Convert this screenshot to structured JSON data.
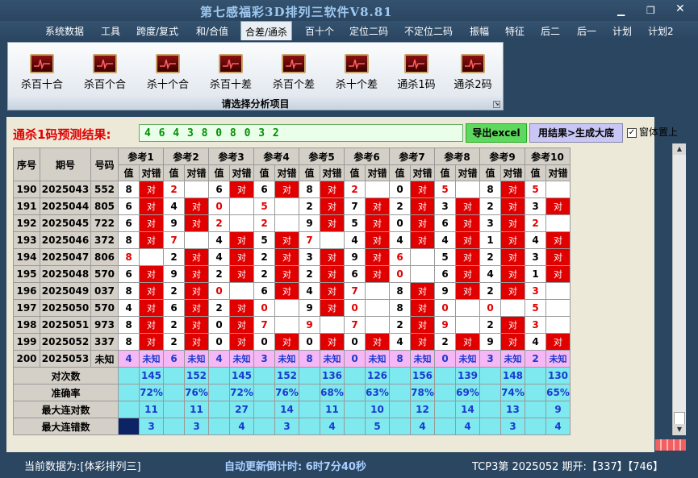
{
  "window": {
    "title": "第七感福彩3D排列三软件V8.81"
  },
  "menu": [
    "系统数据",
    "工具",
    "跨度/复式",
    "和/合值",
    "合差/通杀",
    "百十个",
    "定位二码",
    "不定位二码",
    "振幅",
    "特征",
    "后二",
    "后一",
    "计划",
    "计划2"
  ],
  "menu_active_index": 4,
  "ribbon": {
    "buttons": [
      "杀百十合",
      "杀百个合",
      "杀十个合",
      "杀百十差",
      "杀百个差",
      "杀十个差",
      "通杀1码",
      "通杀2码"
    ],
    "footer": "请选择分析项目"
  },
  "result": {
    "label": "通杀1码预测结果:",
    "value": "4 6 4 3 8 0 8 0 3 2",
    "excel_button": "导出excel",
    "generate_button": "用结果>生成大底",
    "checkbox_label": "窗体置上",
    "checkbox_checked": true
  },
  "table": {
    "headers": {
      "seq": "序号",
      "period": "期号",
      "number": "号码"
    },
    "ref_labels": [
      "参考1",
      "参考2",
      "参考3",
      "参考4",
      "参考5",
      "参考6",
      "参考7",
      "参考8",
      "参考9",
      "参考10"
    ],
    "sub_value": "值",
    "sub_result": "对错",
    "hit_text": "对",
    "rows": [
      {
        "seq": "190",
        "period": "2025043",
        "number": "552",
        "refs": [
          [
            "8",
            1
          ],
          [
            "2",
            0
          ],
          [
            "6",
            1
          ],
          [
            "6",
            1
          ],
          [
            "8",
            1
          ],
          [
            "2",
            0
          ],
          [
            "0",
            1
          ],
          [
            "5",
            0
          ],
          [
            "8",
            1
          ],
          [
            "5",
            0
          ]
        ]
      },
      {
        "seq": "191",
        "period": "2025044",
        "number": "805",
        "refs": [
          [
            "6",
            1
          ],
          [
            "4",
            1
          ],
          [
            "0",
            0
          ],
          [
            "5",
            0
          ],
          [
            "2",
            1
          ],
          [
            "7",
            1
          ],
          [
            "2",
            1
          ],
          [
            "3",
            1
          ],
          [
            "2",
            1
          ],
          [
            "3",
            1
          ]
        ]
      },
      {
        "seq": "192",
        "period": "2025045",
        "number": "722",
        "refs": [
          [
            "6",
            1
          ],
          [
            "9",
            1
          ],
          [
            "2",
            0
          ],
          [
            "2",
            0
          ],
          [
            "9",
            1
          ],
          [
            "5",
            1
          ],
          [
            "0",
            1
          ],
          [
            "6",
            1
          ],
          [
            "3",
            1
          ],
          [
            "2",
            0
          ]
        ]
      },
      {
        "seq": "193",
        "period": "2025046",
        "number": "372",
        "refs": [
          [
            "8",
            1
          ],
          [
            "7",
            0
          ],
          [
            "4",
            1
          ],
          [
            "5",
            1
          ],
          [
            "7",
            0
          ],
          [
            "4",
            1
          ],
          [
            "4",
            1
          ],
          [
            "4",
            1
          ],
          [
            "1",
            1
          ],
          [
            "4",
            1
          ]
        ]
      },
      {
        "seq": "194",
        "period": "2025047",
        "number": "806",
        "refs": [
          [
            "8",
            0
          ],
          [
            "2",
            1
          ],
          [
            "4",
            1
          ],
          [
            "2",
            1
          ],
          [
            "3",
            1
          ],
          [
            "9",
            1
          ],
          [
            "6",
            0
          ],
          [
            "5",
            1
          ],
          [
            "2",
            1
          ],
          [
            "3",
            1
          ]
        ]
      },
      {
        "seq": "195",
        "period": "2025048",
        "number": "570",
        "refs": [
          [
            "6",
            1
          ],
          [
            "9",
            1
          ],
          [
            "2",
            1
          ],
          [
            "2",
            1
          ],
          [
            "2",
            1
          ],
          [
            "6",
            1
          ],
          [
            "0",
            0
          ],
          [
            "6",
            1
          ],
          [
            "4",
            1
          ],
          [
            "1",
            1
          ]
        ]
      },
      {
        "seq": "196",
        "period": "2025049",
        "number": "037",
        "refs": [
          [
            "8",
            1
          ],
          [
            "2",
            1
          ],
          [
            "0",
            0
          ],
          [
            "6",
            1
          ],
          [
            "4",
            1
          ],
          [
            "7",
            0
          ],
          [
            "8",
            1
          ],
          [
            "9",
            1
          ],
          [
            "2",
            1
          ],
          [
            "3",
            0
          ]
        ]
      },
      {
        "seq": "197",
        "period": "2025050",
        "number": "570",
        "refs": [
          [
            "4",
            1
          ],
          [
            "6",
            1
          ],
          [
            "2",
            1
          ],
          [
            "0",
            0
          ],
          [
            "9",
            1
          ],
          [
            "0",
            0
          ],
          [
            "8",
            1
          ],
          [
            "0",
            0
          ],
          [
            "0",
            0
          ],
          [
            "5",
            0
          ]
        ]
      },
      {
        "seq": "198",
        "period": "2025051",
        "number": "973",
        "refs": [
          [
            "8",
            1
          ],
          [
            "2",
            1
          ],
          [
            "0",
            1
          ],
          [
            "7",
            0
          ],
          [
            "9",
            0
          ],
          [
            "7",
            0
          ],
          [
            "2",
            1
          ],
          [
            "9",
            0
          ],
          [
            "2",
            1
          ],
          [
            "3",
            0
          ]
        ]
      },
      {
        "seq": "199",
        "period": "2025052",
        "number": "337",
        "refs": [
          [
            "8",
            1
          ],
          [
            "2",
            1
          ],
          [
            "0",
            1
          ],
          [
            "0",
            1
          ],
          [
            "0",
            1
          ],
          [
            "0",
            1
          ],
          [
            "4",
            1
          ],
          [
            "2",
            1
          ],
          [
            "9",
            1
          ],
          [
            "4",
            1
          ]
        ]
      }
    ],
    "pending": {
      "seq": "200",
      "period": "2025053",
      "number": "未知",
      "values": [
        "4",
        "6",
        "4",
        "3",
        "8",
        "0",
        "8",
        "0",
        "3",
        "2"
      ],
      "result": "未知"
    },
    "stats": [
      {
        "label": "对次数",
        "values": [
          "145",
          "152",
          "145",
          "152",
          "136",
          "126",
          "156",
          "139",
          "148",
          "130"
        ]
      },
      {
        "label": "准确率",
        "values": [
          "72%",
          "76%",
          "72%",
          "76%",
          "68%",
          "63%",
          "78%",
          "69%",
          "74%",
          "65%"
        ]
      },
      {
        "label": "最大连对数",
        "values": [
          "11",
          "11",
          "27",
          "14",
          "11",
          "10",
          "12",
          "14",
          "13",
          "9"
        ]
      },
      {
        "label": "最大连错数",
        "values": [
          "3",
          "3",
          "4",
          "3",
          "4",
          "5",
          "4",
          "4",
          "3",
          "4"
        ]
      }
    ]
  },
  "status": {
    "current_data": "当前数据为:[体彩排列三]",
    "countdown": "自动更新倒计时:  6时7分40秒",
    "draw_info": "TCP3第 2025052 期开:【337】【746】"
  },
  "colors": {
    "hit": "#e00000",
    "unknown_bg": "#f5b7f5",
    "stats_bg": "#7ee9ef",
    "result_green": "#009000",
    "title": "#9fc8f0"
  }
}
